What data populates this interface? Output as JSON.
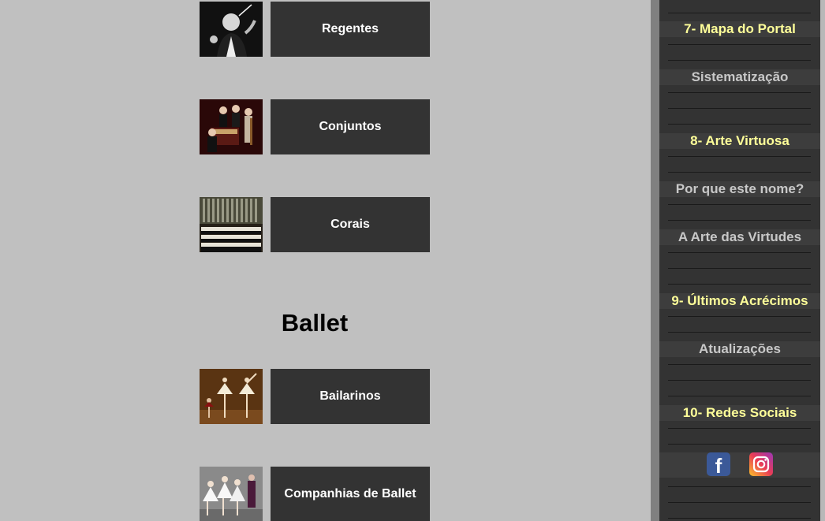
{
  "main": {
    "entries": [
      {
        "label": "Regentes"
      },
      {
        "label": "Conjuntos"
      },
      {
        "label": "Corais"
      },
      {
        "label": "Bailarinos"
      },
      {
        "label": "Companhias de Ballet"
      }
    ],
    "section_heading": "Ballet"
  },
  "sidebar": {
    "items": [
      {
        "label": "7- Mapa do Portal",
        "kind": "heading"
      },
      {
        "label": "Sistematização",
        "kind": "link"
      },
      {
        "label": "8- Arte Virtuosa",
        "kind": "heading"
      },
      {
        "label": "Por que este nome?",
        "kind": "link"
      },
      {
        "label": "A Arte das Virtudes",
        "kind": "link"
      },
      {
        "label": "9- Últimos Acrécimos",
        "kind": "heading"
      },
      {
        "label": "Atualizações",
        "kind": "link"
      },
      {
        "label": "10- Redes Sociais",
        "kind": "heading"
      }
    ],
    "social": [
      {
        "icon": "facebook-icon",
        "glyph": "f",
        "color": "#3b5998"
      },
      {
        "icon": "instagram-icon",
        "color": "#e93c55"
      }
    ],
    "colors": {
      "heading": "#ffff99",
      "link": "#c8c8c8",
      "background": "#333333"
    }
  },
  "colors": {
    "page_background": "#c0c0c0",
    "button_background": "#333333",
    "button_text": "#ffffff"
  }
}
